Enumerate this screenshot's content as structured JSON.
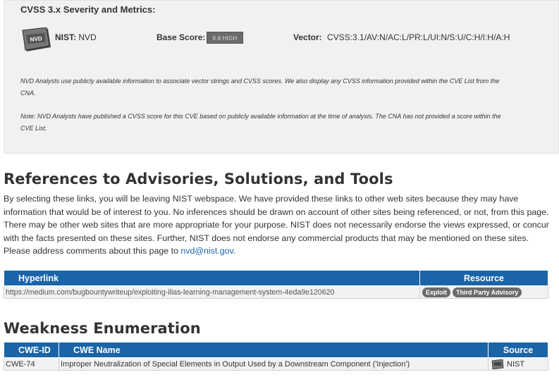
{
  "cvss": {
    "title": "CVSS 3.x Severity and Metrics:",
    "cna_label": "NIST:",
    "cna_value": "NVD",
    "base_score_label": "Base Score:",
    "base_score_value": "8.8 HIGH",
    "vector_label": "Vector:",
    "vector_value": "CVSS:3.1/AV:N/AC:L/PR:L/UI:N/S:U/C:H/I:H/A:H",
    "badge_text": "NVD",
    "note1": "NVD Analysts use publicly available information to associate vector strings and CVSS scores. We also display any CVSS information provided within the CVE List from the CNA.",
    "note2": "Note: NVD Analysts have published a CVSS score for this CVE based on publicly available information at the time of analysis. The CNA has not provided a score within the CVE List."
  },
  "references": {
    "heading": "References to Advisories, Solutions, and Tools",
    "paragraph": "By selecting these links, you will be leaving NIST webspace. We have provided these links to other web sites because they may have information that would be of interest to you. No inferences should be drawn on account of other sites being referenced, or not, from this page. There may be other web sites that are more appropriate for your purpose. NIST does not necessarily endorse the views expressed, or concur with the facts presented on these sites. Further, NIST does not endorse any commercial products that may be mentioned on these sites. Please address comments about this page to",
    "email": "nvd@nist.gov",
    "period": ".",
    "table": {
      "headers": [
        "Hyperlink",
        "Resource"
      ],
      "rows": [
        {
          "hyperlink": "https://medium.com/bugbountywriteup/exploiting-ilias-learning-management-system-4eda9e120620",
          "resources": [
            "Exploit",
            "Third Party Advisory"
          ]
        }
      ]
    }
  },
  "weakness": {
    "heading": "Weakness Enumeration",
    "table": {
      "headers": [
        "CWE-ID",
        "CWE Name",
        "Source"
      ],
      "rows": [
        {
          "id": "CWE-74",
          "name": "Improper Neutralization of Special Elements in Output Used by a Downstream Component ('Injection')",
          "source": "NIST"
        }
      ]
    }
  },
  "colors": {
    "header_blue": "#1a64a8",
    "panel_gray": "#f1f1f1",
    "tag_gray": "#6b6b6b"
  }
}
